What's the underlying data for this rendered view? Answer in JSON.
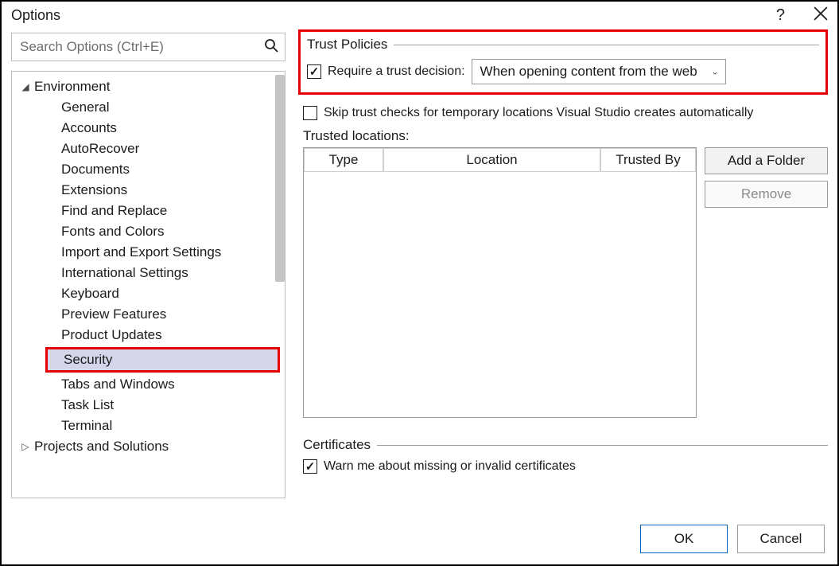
{
  "window": {
    "title": "Options"
  },
  "search": {
    "placeholder": "Search Options (Ctrl+E)"
  },
  "tree": {
    "environment": "Environment",
    "items": [
      "General",
      "Accounts",
      "AutoRecover",
      "Documents",
      "Extensions",
      "Find and Replace",
      "Fonts and Colors",
      "Import and Export Settings",
      "International Settings",
      "Keyboard",
      "Preview Features",
      "Product Updates",
      "Security",
      "Tabs and Windows",
      "Task List",
      "Terminal"
    ],
    "projects": "Projects and Solutions"
  },
  "trust": {
    "group_title": "Trust Policies",
    "require_label": "Require a trust decision:",
    "dropdown_value": "When opening content from the web",
    "skip_label": "Skip trust checks for temporary locations Visual Studio creates automatically",
    "locations_label": "Trusted locations:",
    "cols": {
      "type": "Type",
      "location": "Location",
      "trusted_by": "Trusted By"
    },
    "add_folder": "Add a Folder",
    "remove": "Remove"
  },
  "certs": {
    "group_title": "Certificates",
    "warn_label": "Warn me about missing or invalid certificates"
  },
  "buttons": {
    "ok": "OK",
    "cancel": "Cancel"
  }
}
